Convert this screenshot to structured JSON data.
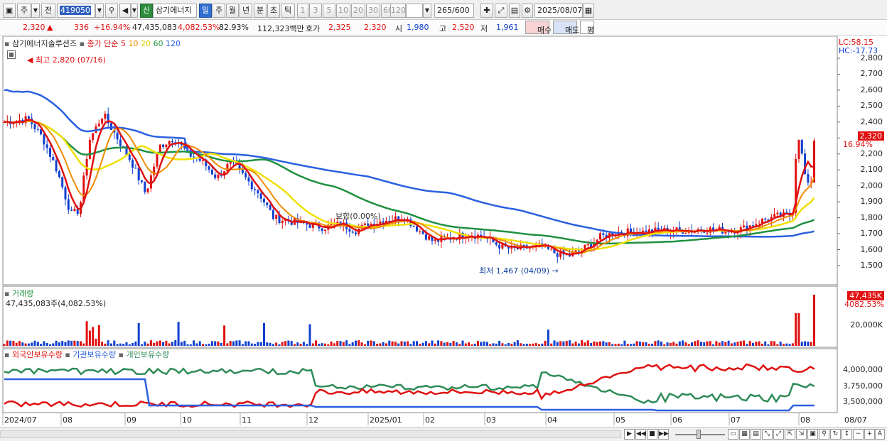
{
  "toolbar": {
    "period_type": "주",
    "mode": "전",
    "code": "419050",
    "name_badge": "신",
    "name": "삼기에너지",
    "periods": [
      "일",
      "주",
      "월",
      "년",
      "분",
      "초",
      "틱"
    ],
    "active_period": "일",
    "steps": [
      "1",
      "3",
      "5",
      "10",
      "20",
      "30",
      "60",
      "120"
    ],
    "count": "265",
    "count_max": "/600",
    "date": "2025/08/07"
  },
  "quote": {
    "price": "2,320",
    "arrow": "▲",
    "change": "336",
    "change_pct": "+16.94%",
    "volume": "47,435,083",
    "vol_ratio": "4,082.53%",
    "turnover": "82.93%",
    "amount": "112,323백만",
    "bid_label": "호가",
    "ask": "2,325",
    "bid": "2,320",
    "open_label": "시",
    "open": "1,980",
    "high_label": "고",
    "high": "2,520",
    "low_label": "저",
    "low": "1,961",
    "buy": "매수",
    "sell": "매도",
    "eval": "평"
  },
  "price_panel": {
    "stock_name": "삼기에너지솔루션즈",
    "ma_label": "종가 단순",
    "ma_periods": [
      "5",
      "10",
      "20",
      "60",
      "120"
    ],
    "ma_colors": [
      "#e01010",
      "#f08c00",
      "#f0e000",
      "#1e9040",
      "#2a5fe0"
    ],
    "high_note": "최고 2,820 (07/16)",
    "low_note": "최저 1,467 (04/09)",
    "mid_note": "보합(0.00%)",
    "lc": "LC:58.15",
    "hc": "HC:-17.73",
    "current_price": "2,320",
    "current_pct": "16.94%",
    "y_ticks": [
      "2,800",
      "2,700",
      "2,600",
      "2,500",
      "2,400",
      "2,300",
      "2,200",
      "2,100",
      "2,000",
      "1,900",
      "1,800",
      "1,700",
      "1,600",
      "1,500"
    ]
  },
  "volume_panel": {
    "title": "거래량",
    "summary": "47,435,083주(4,082.53%)",
    "current_box": "47,435K",
    "current_pct": "4082.53%",
    "tick": "20,000K"
  },
  "holdings_panel": {
    "legend": [
      "외국인보유수량",
      "기관보유수량",
      "개인보유수량"
    ],
    "colors": [
      "#e01010",
      "#2a5fe0",
      "#2e8b57"
    ],
    "y_ticks": [
      "4,000,000",
      "3,750,000",
      "3,500,000"
    ]
  },
  "x_axis": [
    "2024/07",
    "08",
    "09",
    "10",
    "11",
    "12",
    "2025/01",
    "02",
    "03",
    "04",
    "05",
    "06",
    "07",
    "08"
  ],
  "x_axis_end": "08/07"
}
